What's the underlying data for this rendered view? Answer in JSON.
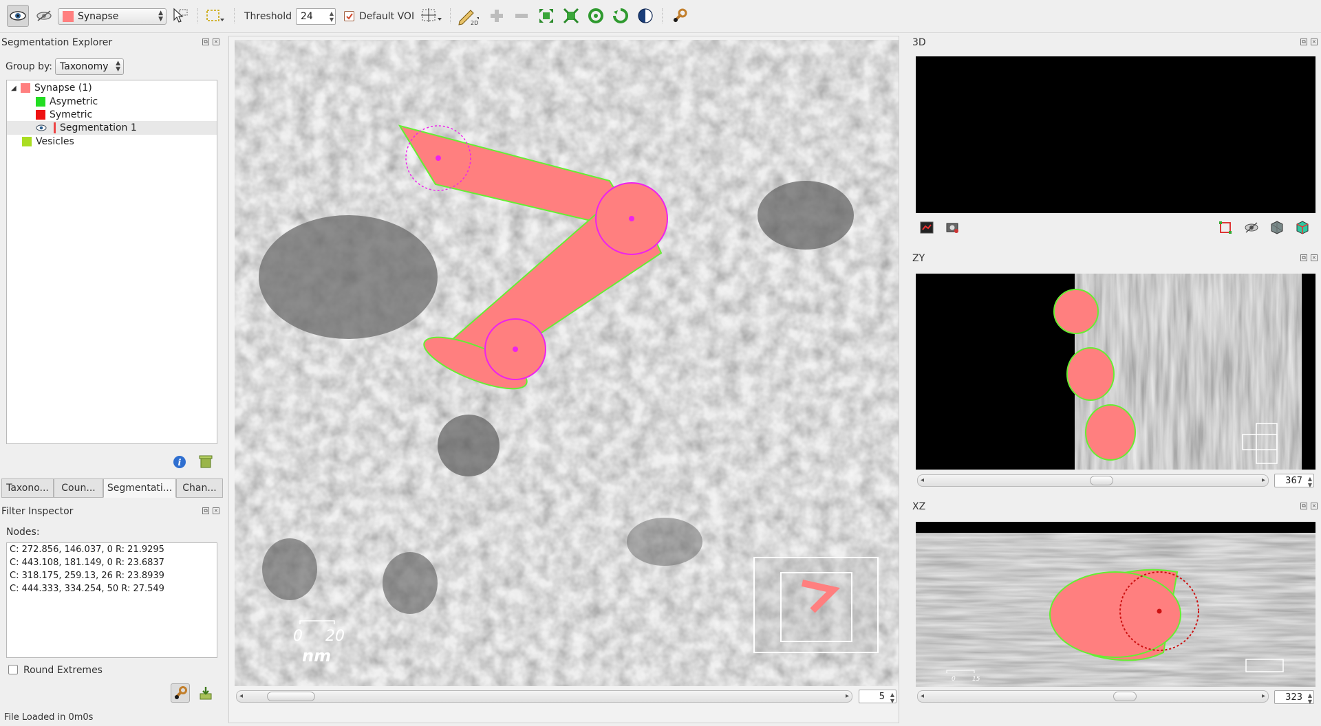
{
  "toolbar": {
    "segmentation_category": "Synapse",
    "threshold_label": "Threshold",
    "threshold_value": "24",
    "default_voi_label": "Default VOI",
    "default_voi_checked": true
  },
  "segmentation_explorer": {
    "title": "Segmentation Explorer",
    "group_by_label": "Group by:",
    "group_by_value": "Taxonomy",
    "tree": [
      {
        "label": "Synapse (1)",
        "color": "#ff7f7f"
      },
      {
        "label": "Asymetric",
        "color": "#22dd22"
      },
      {
        "label": "Symetric",
        "color": "#ee1111"
      },
      {
        "label": "Segmentation 1",
        "color": "#ff7f7f"
      },
      {
        "label": "Vesicles",
        "color": "#aadd22"
      }
    ],
    "tabs": [
      "Taxono...",
      "Coun...",
      "Segmentati...",
      "Chan..."
    ],
    "selected_tab": "Segmentati..."
  },
  "filter_inspector": {
    "title": "Filter Inspector",
    "nodes_label": "Nodes:",
    "nodes": [
      "C: 272.856, 146.037, 0 R: 21.9295",
      "C: 443.108, 181.149, 0 R: 23.6837",
      "C: 318.175, 259.13, 26 R: 23.8939",
      "C: 444.333, 334.254, 50 R: 27.549"
    ],
    "round_extremes_label": "Round Extremes",
    "round_extremes_checked": false
  },
  "main_view": {
    "scale_min": "0",
    "scale_max": "20",
    "scale_unit": "nm",
    "slice": "5"
  },
  "views": {
    "view3d_title": "3D",
    "zy_title": "ZY",
    "zy_slice": "367",
    "xz_title": "XZ",
    "xz_slice": "323",
    "xz_scale_min": "0",
    "xz_scale_max": "15"
  },
  "status_bar": {
    "message": "File Loaded in 0m0s"
  },
  "colors": {
    "segmentation_fill": "#ff7f7f",
    "outline_green": "#66ee33",
    "node_magenta": "#ee22ee"
  },
  "icons": [
    "eye-icon",
    "eye-hidden-icon",
    "pointer-select-icon",
    "region-select-icon",
    "voi-tool-icon",
    "pencil-2d-icon",
    "plus-icon",
    "minus-icon",
    "dilate-icon",
    "erode-icon",
    "fill-icon",
    "close-icon-green",
    "open-icon",
    "filter-wrench-icon",
    "info-icon",
    "delete-icon",
    "gear-icon"
  ]
}
